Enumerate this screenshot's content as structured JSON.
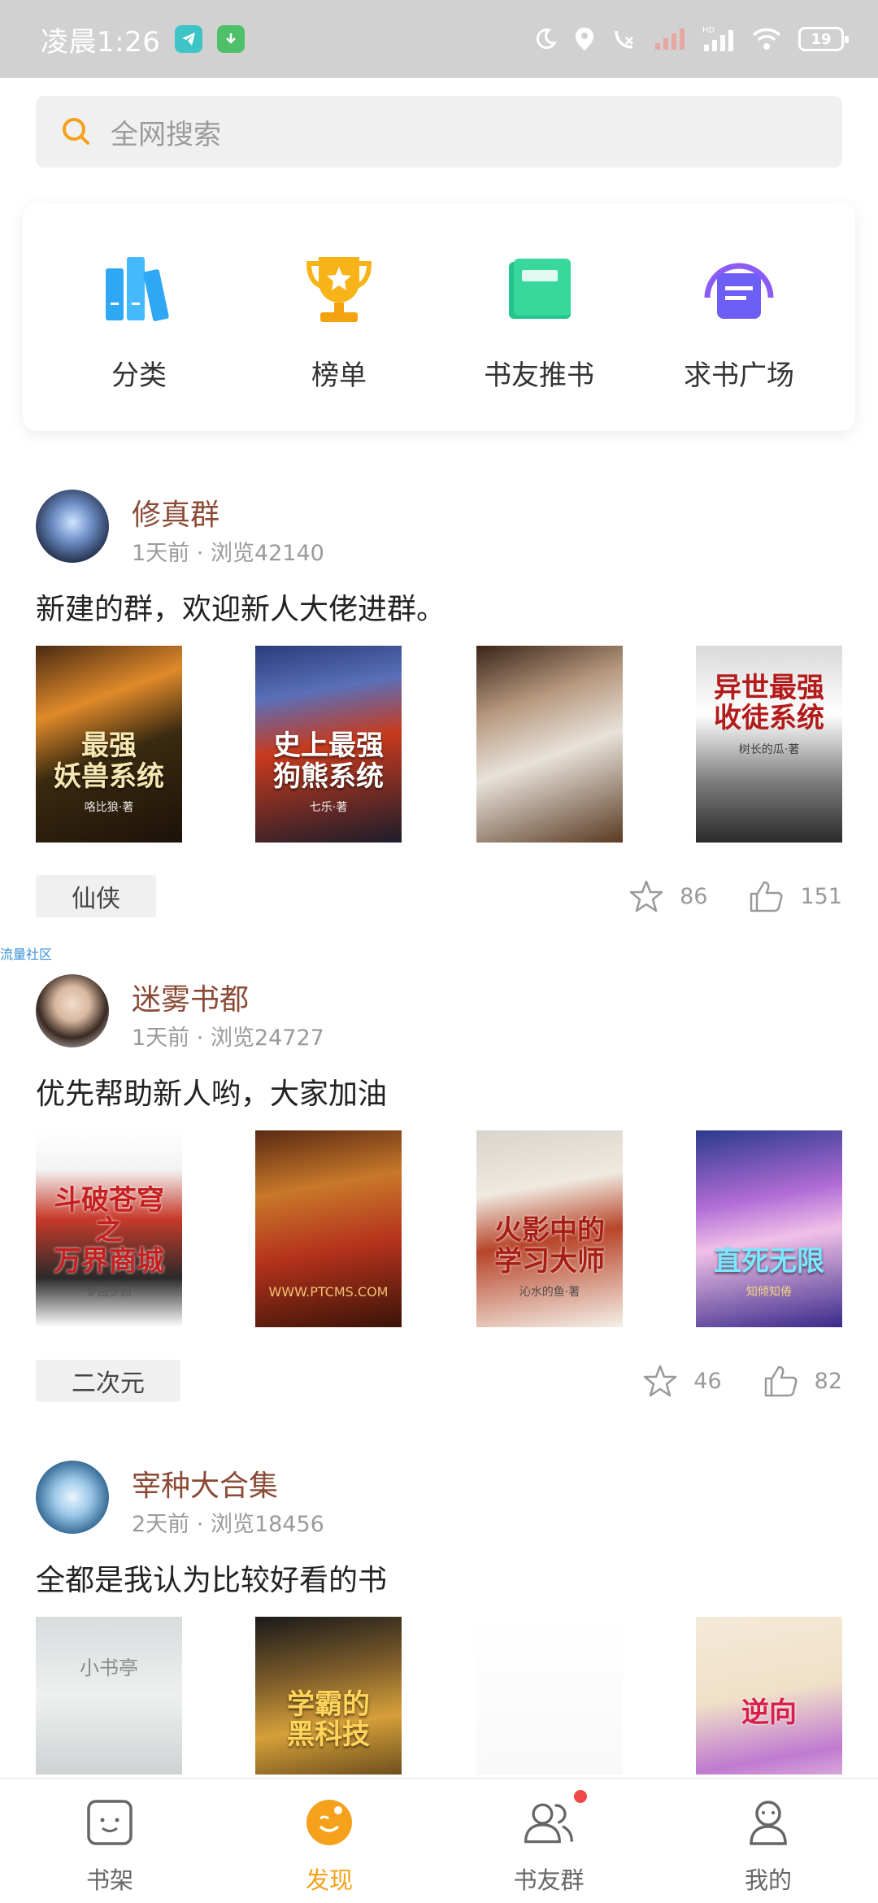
{
  "status_bar": {
    "time": "凌晨1:26",
    "battery": "19"
  },
  "search": {
    "placeholder": "全网搜索"
  },
  "quick_nav": [
    {
      "label": "分类",
      "icon": "books-icon"
    },
    {
      "label": "榜单",
      "icon": "trophy-icon"
    },
    {
      "label": "书友推书",
      "icon": "book-icon"
    },
    {
      "label": "求书广场",
      "icon": "headphones-icon"
    }
  ],
  "posts": [
    {
      "title": "修真群",
      "time": "1天前",
      "views": "浏览42140",
      "text": "新建的群，欢迎新人大佬进群。",
      "tag": "仙侠",
      "favorites": "86",
      "likes": "151",
      "covers": [
        {
          "title": "最强\n妖兽系统",
          "author": "咯比狼·著"
        },
        {
          "title": "史上最强\n狗熊系统",
          "author": "七乐·著"
        },
        {
          "title": "",
          "author": ""
        },
        {
          "title": "异世最强\n收徒系统",
          "author": "树长的瓜·著"
        }
      ]
    },
    {
      "title": "迷雾书都",
      "time": "1天前",
      "views": "浏览24727",
      "text": "优先帮助新人哟，大家加油",
      "tag": "二次元",
      "favorites": "46",
      "likes": "82",
      "covers": [
        {
          "title": "斗破苍穹之\n万界商城",
          "author": "梦回夕照"
        },
        {
          "title": "",
          "author": "WWW.PTCMS.COM"
        },
        {
          "title": "火影中的\n学习大师",
          "author": "沁水的鱼·著"
        },
        {
          "title": "直死无限",
          "author": "知倾知倦"
        }
      ]
    },
    {
      "title": "宰种大合集",
      "time": "2天前",
      "views": "浏览18456",
      "text": "全都是我认为比较好看的书",
      "covers": [
        {
          "title": "小书亭",
          "author": ""
        },
        {
          "title": "学霸的\n黑科技",
          "author": ""
        },
        {
          "title": "",
          "author": ""
        },
        {
          "title": "逆向",
          "author": ""
        }
      ]
    }
  ],
  "ad_label": "流量社区",
  "bottom_nav": [
    {
      "label": "书架",
      "icon": "bookshelf-icon",
      "active": false
    },
    {
      "label": "发现",
      "icon": "discover-icon",
      "active": true
    },
    {
      "label": "书友群",
      "icon": "group-icon",
      "active": false,
      "badge": true
    },
    {
      "label": "我的",
      "icon": "profile-icon",
      "active": false
    }
  ],
  "colors": {
    "accent": "#f5a11c",
    "post_title": "#8a4a36",
    "badge": "#f24848"
  }
}
